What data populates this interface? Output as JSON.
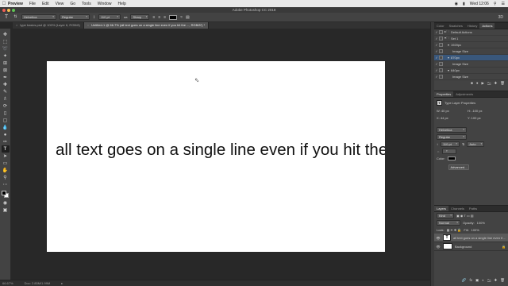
{
  "menubar": {
    "app": "Preview",
    "items": [
      "File",
      "Edit",
      "View",
      "Go",
      "Tools",
      "Window",
      "Help"
    ],
    "clock": "Wed 12:06"
  },
  "window": {
    "title": "Adobe Photoshop CC 2018"
  },
  "options": {
    "font_family": "Helvetica",
    "font_style": "Regular",
    "font_size": "110 pt",
    "antialias": "Sharp",
    "color": "#000000"
  },
  "tabs": [
    {
      "label": "type basics.psd @ 100% (Layer 6, RGB/8)",
      "active": false
    },
    {
      "label": "Untitled-1 @ 66.7% (all text goes on a single line even if you hit the ..., RGB/8*) *",
      "active": true
    }
  ],
  "canvas": {
    "text": "all text goes on a single line even if you hit the"
  },
  "status": {
    "zoom": "66.67%",
    "doc": "Doc: 2.85M/1.99M"
  },
  "panels": {
    "top_tabs": [
      "Color",
      "Swatches",
      "History",
      "Actions"
    ],
    "actions": [
      {
        "label": "Default Actions",
        "level": 0
      },
      {
        "label": "Set 1",
        "level": 0
      },
      {
        "label": "1920px",
        "level": 1
      },
      {
        "label": "Image Size",
        "level": 2
      },
      {
        "label": "870px",
        "level": 1
      },
      {
        "label": "Image Size",
        "level": 2
      },
      {
        "label": "640px",
        "level": 1
      },
      {
        "label": "Image Size",
        "level": 2
      }
    ],
    "prop_tabs": [
      "Properties",
      "Adjustments"
    ],
    "properties": {
      "header": "Type Layer Properties",
      "w": "W: 40 px",
      "h": "H: -100 px",
      "x": "X: 44 px",
      "y": "Y: 100 px",
      "font_family": "Helvetica",
      "font_style": "Regular",
      "size": "110 pt",
      "auto": "Auto",
      "color_label": "Color:",
      "advanced": "Advanced..."
    },
    "layer_tabs": [
      "Layers",
      "Channels",
      "Paths"
    ],
    "layers": {
      "kind": "Kind",
      "blend": "Normal",
      "opacity_label": "Opacity:",
      "opacity": "100%",
      "lock_label": "Lock:",
      "fill_label": "Fill:",
      "fill": "100%",
      "items": [
        {
          "name": "all text goes on a single line even if ...",
          "type": "T"
        },
        {
          "name": "Background",
          "type": ""
        }
      ]
    }
  }
}
